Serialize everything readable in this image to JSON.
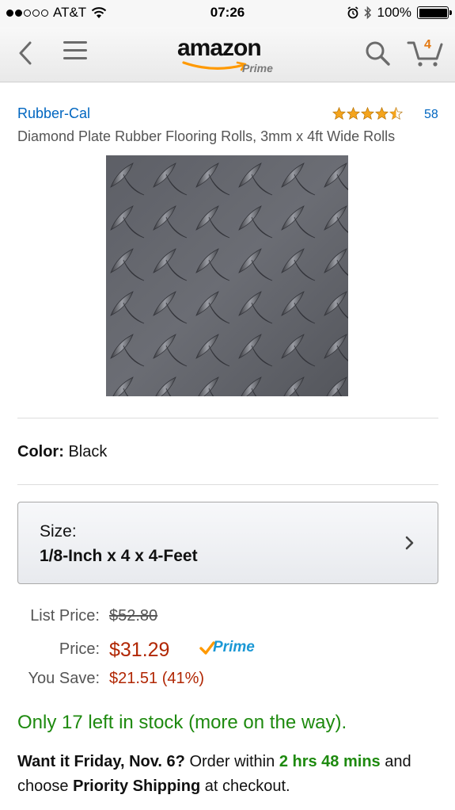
{
  "status_bar": {
    "carrier": "AT&T",
    "time": "07:26",
    "battery": "100%",
    "signal_bars_filled": 2,
    "signal_bars_total": 5
  },
  "nav": {
    "logo_text": "amazon",
    "logo_sub": "Prime",
    "cart_count": "4",
    "icons": [
      "chevron-left-icon",
      "menu-icon",
      "search-icon",
      "cart-icon"
    ]
  },
  "product": {
    "brand": "Rubber-Cal",
    "rating_stars": 4.5,
    "review_count": "58",
    "title": "Diamond Plate Rubber Flooring Rolls, 3mm x 4ft Wide Rolls",
    "color_label": "Color:",
    "color_value": "Black"
  },
  "size_selector": {
    "label": "Size:",
    "value": "1/8-Inch x 4 x 4-Feet"
  },
  "pricing": {
    "list_label": "List Price:",
    "list_value": "$52.80",
    "price_label": "Price:",
    "price_value": "$31.29",
    "prime_badge": "Prime",
    "save_label": "You Save:",
    "save_value": "$21.51 (41%)"
  },
  "availability": {
    "stock_text": "Only 17 left in stock (more on the way).",
    "want_it": "Want it Friday, Nov. 6?",
    "order_within": "Order within",
    "time_left": "2 hrs 48 mins",
    "and_choose": "and choose",
    "shipping": "Priority Shipping",
    "at_checkout": "at checkout."
  },
  "colors": {
    "link": "#0066c0",
    "price": "#b12704",
    "stock": "#1e8a0f",
    "star": "#f4a41d",
    "amazon_orange": "#ff9900"
  }
}
